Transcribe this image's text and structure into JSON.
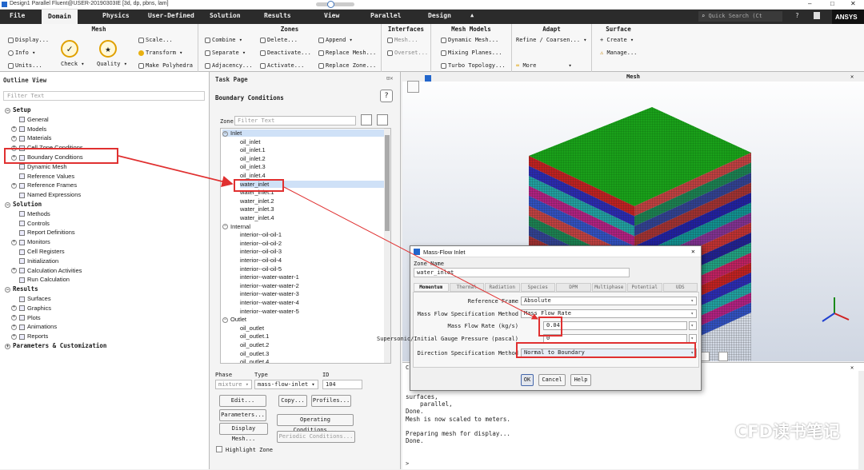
{
  "window": {
    "title": "Design1 Parallel Fluent@USER-20190303IE [3d, dp, pbns, lam]"
  },
  "menu_tabs": [
    "File",
    "Domain",
    "Physics",
    "User-Defined",
    "Solution",
    "Results",
    "View",
    "Parallel",
    "Design"
  ],
  "active_tab": "Domain",
  "search_placeholder": "Quick Search (Ct",
  "brand": "ANSYS",
  "ribbon": {
    "mesh": {
      "title": "Mesh",
      "display": "Display...",
      "info": "Info",
      "units": "Units...",
      "check": "Check",
      "quality": "Quality",
      "scale": "Scale...",
      "transform": "Transform",
      "polyhedra": "Make Polyhedra"
    },
    "zones": {
      "title": "Zones",
      "combine": "Combine",
      "separate": "Separate",
      "adjacency": "Adjacency...",
      "delete": "Delete...",
      "deactivate": "Deactivate...",
      "activate": "Activate...",
      "append": "Append",
      "replace_mesh": "Replace Mesh...",
      "replace_zone": "Replace Zone..."
    },
    "interfaces": {
      "title": "Interfaces",
      "mesh": "Mesh...",
      "overset": "Overset..."
    },
    "mesh_models": {
      "title": "Mesh Models",
      "dynamic": "Dynamic Mesh...",
      "mixing": "Mixing Planes...",
      "turbo": "Turbo Topology..."
    },
    "adapt": {
      "title": "Adapt",
      "refine": "Refine / Coarsen...",
      "more": "More"
    },
    "surface": {
      "title": "Surface",
      "create": "+ Create",
      "manage": "Manage..."
    }
  },
  "outline": {
    "title": "Outline View",
    "filter": "Filter Text",
    "setup": "Setup",
    "setup_items": [
      "General",
      "Models",
      "Materials",
      "Cell Zone Conditions",
      "Boundary Conditions",
      "Dynamic Mesh",
      "Reference Values",
      "Reference Frames",
      "Named Expressions"
    ],
    "solution": "Solution",
    "solution_items": [
      "Methods",
      "Controls",
      "Report Definitions",
      "Monitors",
      "Cell Registers",
      "Initialization",
      "Calculation Activities",
      "Run Calculation"
    ],
    "results": "Results",
    "results_items": [
      "Surfaces",
      "Graphics",
      "Plots",
      "Animations",
      "Reports"
    ],
    "params": "Parameters & Customization"
  },
  "task": {
    "title": "Task Page",
    "heading": "Boundary Conditions",
    "zone_label": "Zone",
    "zone_filter": "Filter Text",
    "groups": {
      "inlet": "Inlet",
      "inlet_items": [
        "oil_inlet",
        "oil_inlet.1",
        "oil_inlet.2",
        "oil_inlet.3",
        "oil_inlet.4",
        "water_inlet",
        "water_inlet.1",
        "water_inlet.2",
        "water_inlet.3",
        "water_inlet.4"
      ],
      "internal": "Internal",
      "internal_items": [
        "interior--oil-oil-1",
        "interior--oil-oil-2",
        "interior--oil-oil-3",
        "interior--oil-oil-4",
        "interior--oil-oil-5",
        "interior--water-water-1",
        "interior--water-water-2",
        "interior--water-water-3",
        "interior--water-water-4",
        "interior--water-water-5"
      ],
      "outlet": "Outlet",
      "outlet_items": [
        "oil_outlet",
        "oil_outlet.1",
        "oil_outlet.2",
        "oil_outlet.3",
        "oil_outlet.4"
      ]
    },
    "phase_label": "Phase",
    "phase_value": "mixture",
    "type_label": "Type",
    "type_value": "mass-flow-inlet",
    "id_label": "ID",
    "id_value": "104",
    "buttons": {
      "edit": "Edit...",
      "copy": "Copy...",
      "profiles": "Profiles...",
      "parameters": "Parameters...",
      "operating": "Operating Conditions...",
      "display_mesh": "Display Mesh...",
      "periodic": "Periodic Conditions..."
    },
    "highlight": "Highlight Zone"
  },
  "graphics": {
    "title": "Mesh"
  },
  "dialog": {
    "title": "Mass-Flow Inlet",
    "zone_name_label": "Zone Name",
    "zone_name": "water_inlet",
    "tabs": [
      "Momentum",
      "Thermal",
      "Radiation",
      "Species",
      "DPM",
      "Multiphase",
      "Potential",
      "UDS"
    ],
    "ref_frame_label": "Reference Frame",
    "ref_frame": "Absolute",
    "spec_method_label": "Mass Flow Specification Method",
    "spec_method": "Mass Flow Rate",
    "rate_label": "Mass Flow Rate (kg/s)",
    "rate_value": "0.04",
    "pressure_label": "Supersonic/Initial Gauge Pressure (pascal)",
    "pressure_value": "0",
    "direction_label": "Direction Specification Method",
    "direction_value": "Normal to Boundary",
    "ok": "OK",
    "cancel": "Cancel",
    "help": "Help"
  },
  "console_text": "surfaces,\n    parallel,\nDone.\nMesh is now scaled to meters.\n\nPreparing mesh for display...\nDone.",
  "console_prompt": ">",
  "watermark": "CFD读书笔记",
  "colors": {
    "accent_red": "#e03030",
    "mesh_green": "#1aa01a",
    "tab_bar": "#2b2b2b"
  }
}
